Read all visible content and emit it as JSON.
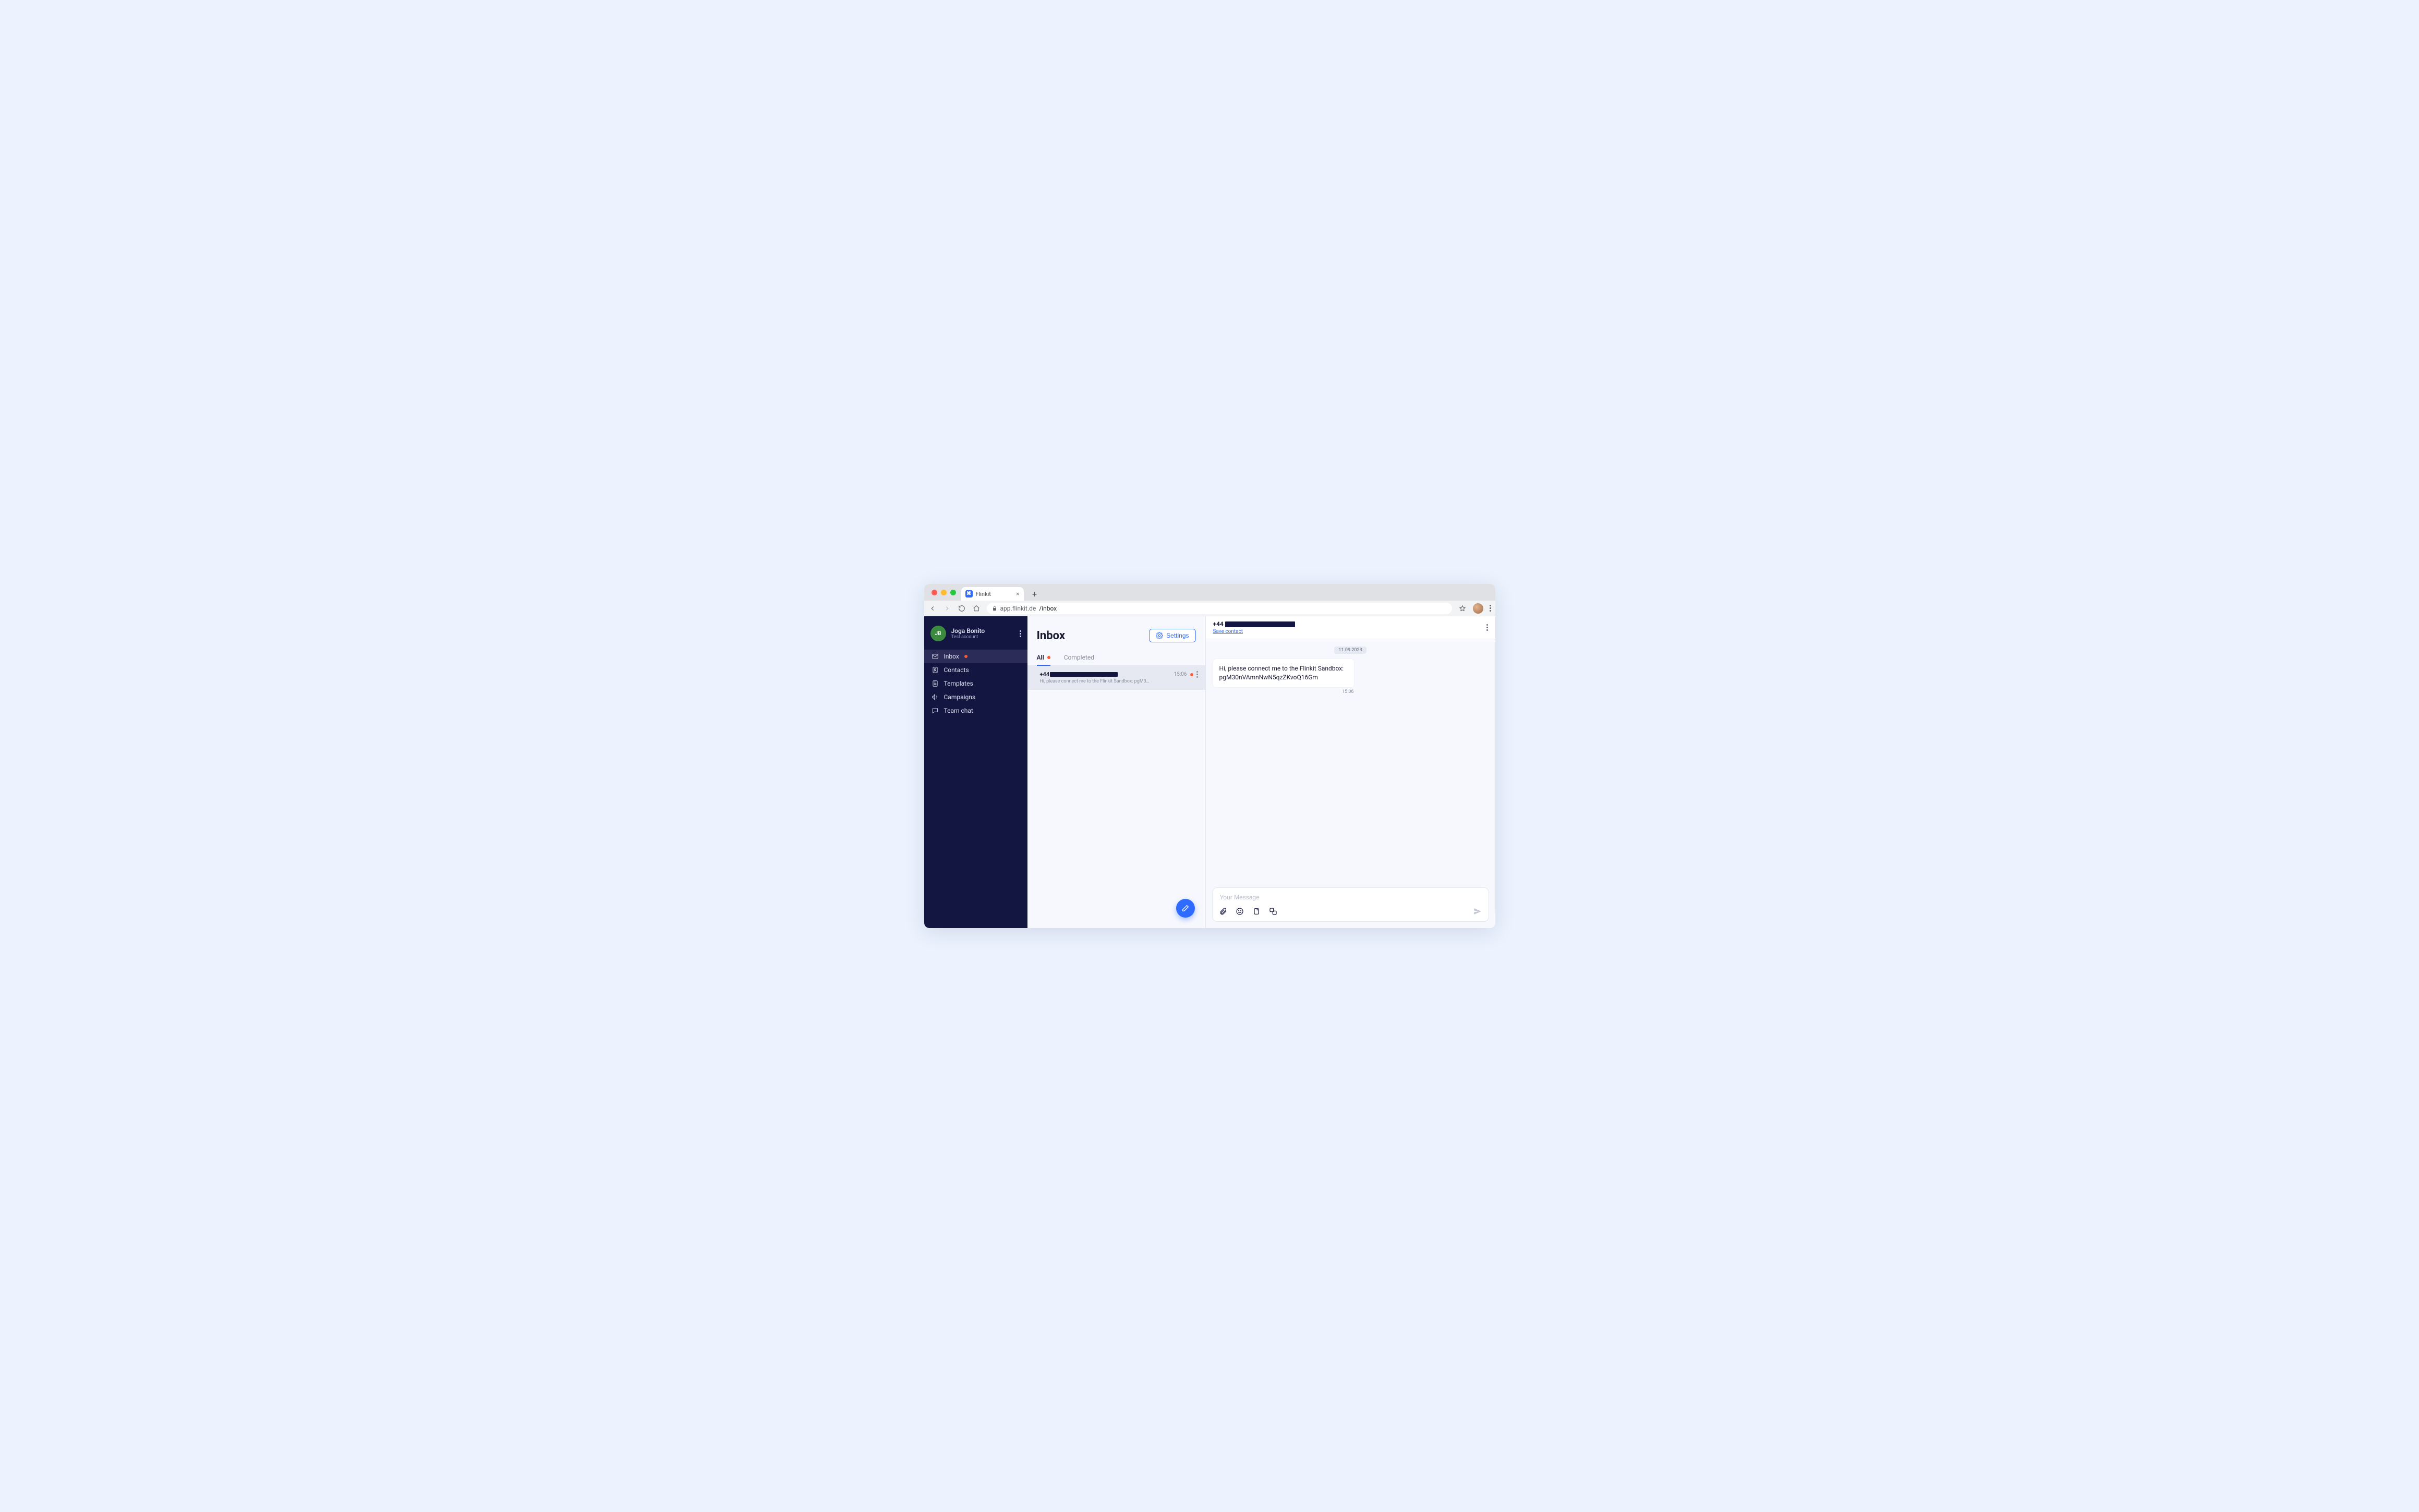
{
  "browser": {
    "tab_title": "Flinkit",
    "url_host": "app.flinkit.de",
    "url_path": "/inbox"
  },
  "sidebar": {
    "avatar_initials": "JB",
    "user_name": "Joga Bonito",
    "user_sub": "Test account",
    "items": [
      {
        "label": "Inbox",
        "icon": "mail-icon",
        "selected": true,
        "notif": true
      },
      {
        "label": "Contacts",
        "icon": "contacts-icon",
        "selected": false,
        "notif": false
      },
      {
        "label": "Templates",
        "icon": "template-icon",
        "selected": false,
        "notif": false
      },
      {
        "label": "Campaigns",
        "icon": "megaphone-icon",
        "selected": false,
        "notif": false
      },
      {
        "label": "Team chat",
        "icon": "chat-icon",
        "selected": false,
        "notif": false
      }
    ]
  },
  "inbox": {
    "title": "Inbox",
    "settings_label": "Settings",
    "tabs": [
      {
        "label": "All",
        "active": true,
        "notif": true
      },
      {
        "label": "Completed",
        "active": false,
        "notif": false
      }
    ],
    "conversations": [
      {
        "name_prefix": "+44",
        "preview": "Hi, please connect me to the Flinkit Sandbox: pgM3…",
        "time": "15:06",
        "unread": true,
        "selected": true
      }
    ]
  },
  "chat": {
    "contact_prefix": "+44",
    "save_contact_label": "Save contact",
    "date_chip": "11.09.2023",
    "messages": [
      {
        "text": "Hi, please connect me to the Flinkit Sandbox: pgM30nVAmnNwN5qzZKvoQ16Gm",
        "time": "15:06",
        "inbound": true
      }
    ],
    "composer_placeholder": "Your Message"
  }
}
